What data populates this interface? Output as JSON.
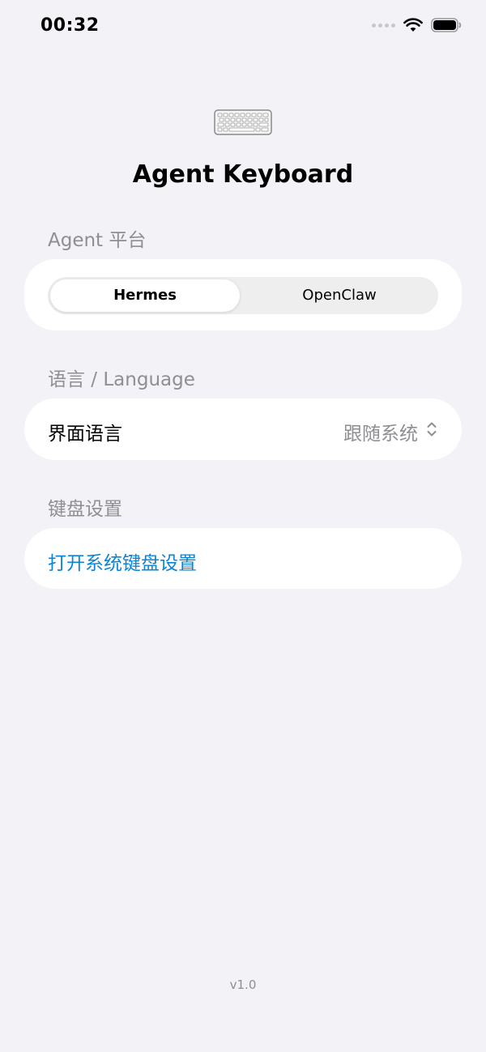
{
  "status_bar": {
    "time": "00:32",
    "icons": [
      "signal-dots-icon",
      "wifi-icon",
      "battery-icon"
    ]
  },
  "header": {
    "icon": "keyboard-icon",
    "title": "Agent Keyboard"
  },
  "platform_section": {
    "label": "Agent 平台",
    "options": [
      "Hermes",
      "OpenClaw"
    ],
    "selected": "Hermes"
  },
  "language_section": {
    "label": "语言 / Language",
    "row_label": "界面语言",
    "row_value": "跟随系统",
    "row_icon": "chevron-up-down-icon"
  },
  "keyboard_section": {
    "label": "键盘设置",
    "link_label": "打开系统键盘设置"
  },
  "footer": {
    "version": "v1.0"
  },
  "colors": {
    "background": "#f2f2f7",
    "card": "#ffffff",
    "secondary_text": "#8e8e93",
    "link": "#0a84d6"
  }
}
